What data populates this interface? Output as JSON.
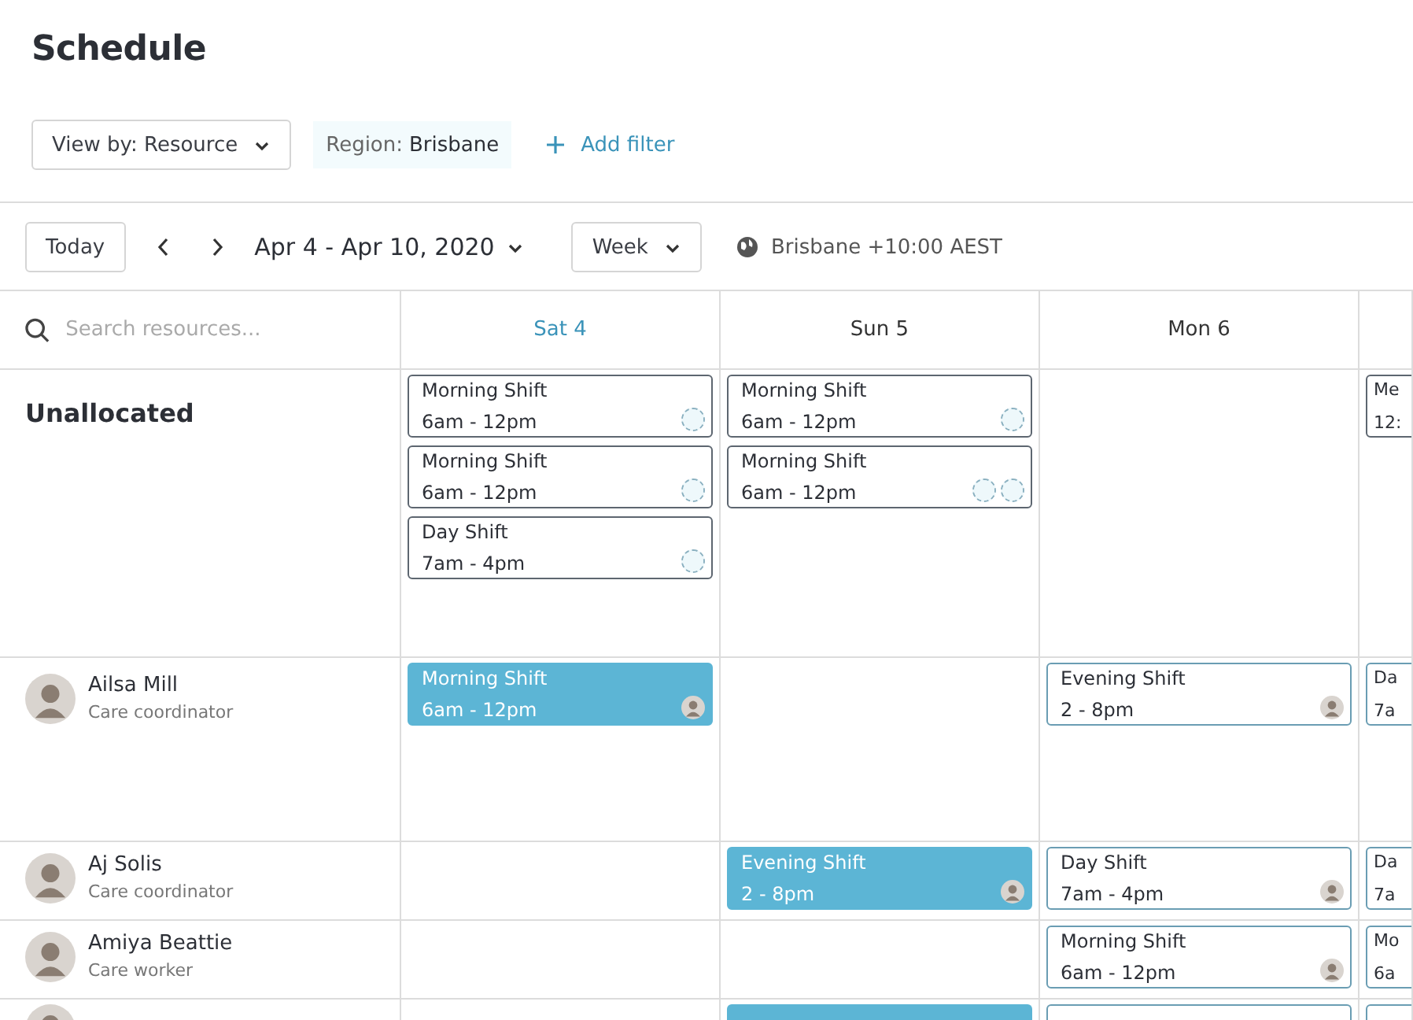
{
  "page": {
    "title": "Schedule"
  },
  "filters": {
    "view_by": "View by: Resource",
    "region_label": "Region:",
    "region_value": "Brisbane",
    "add_filter": "Add filter"
  },
  "toolbar": {
    "today": "Today",
    "date_range": "Apr 4 - Apr 10, 2020",
    "period": "Week",
    "timezone": "Brisbane +10:00 AEST"
  },
  "search": {
    "placeholder": "Search resources..."
  },
  "days": [
    {
      "label": "Sat 4",
      "selected": true
    },
    {
      "label": "Sun 5",
      "selected": false
    },
    {
      "label": "Mon 6",
      "selected": false
    }
  ],
  "rows": [
    {
      "kind": "unallocated",
      "name": "Unallocated",
      "cells": [
        [
          {
            "title": "Morning Shift",
            "time": "6am - 12pm",
            "highlighted": false,
            "slots": [
              {
                "assigned": false
              }
            ]
          },
          {
            "title": "Morning Shift",
            "time": "6am - 12pm",
            "highlighted": false,
            "slots": [
              {
                "assigned": false
              }
            ]
          },
          {
            "title": "Day Shift",
            "time": "7am - 4pm",
            "highlighted": false,
            "slots": [
              {
                "assigned": false
              }
            ]
          }
        ],
        [
          {
            "title": "Morning Shift",
            "time": "6am - 12pm",
            "highlighted": false,
            "slots": [
              {
                "assigned": false
              }
            ]
          },
          {
            "title": "Morning Shift",
            "time": "6am - 12pm",
            "highlighted": false,
            "slots": [
              {
                "assigned": false
              },
              {
                "assigned": false
              }
            ]
          }
        ],
        [],
        [
          {
            "title": "Me",
            "time": "12:",
            "highlighted": false
          }
        ]
      ]
    },
    {
      "kind": "person",
      "name": "Ailsa Mill",
      "role": "Care coordinator",
      "cells": [
        [
          {
            "title": "Morning Shift",
            "time": "6am - 12pm",
            "highlighted": true,
            "slots": [
              {
                "assigned": true
              }
            ]
          }
        ],
        [],
        [
          {
            "title": "Evening Shift",
            "time": "2 - 8pm",
            "highlighted": false,
            "slots": [
              {
                "assigned": true
              }
            ]
          }
        ],
        [
          {
            "title": "Da",
            "time": "7a",
            "highlighted": false
          }
        ]
      ]
    },
    {
      "kind": "person",
      "name": "Aj Solis",
      "role": "Care coordinator",
      "cells": [
        [],
        [
          {
            "title": "Evening Shift",
            "time": "2 - 8pm",
            "highlighted": true,
            "slots": [
              {
                "assigned": true
              }
            ]
          }
        ],
        [
          {
            "title": "Day Shift",
            "time": "7am - 4pm",
            "highlighted": false,
            "slots": [
              {
                "assigned": true
              }
            ]
          }
        ],
        [
          {
            "title": "Da",
            "time": "7a",
            "highlighted": false
          }
        ]
      ]
    },
    {
      "kind": "person",
      "name": "Amiya Beattie",
      "role": "Care worker",
      "cells": [
        [],
        [],
        [
          {
            "title": "Morning Shift",
            "time": "6am - 12pm",
            "highlighted": false,
            "slots": [
              {
                "assigned": true
              }
            ]
          }
        ],
        [
          {
            "title": "Mo",
            "time": "6a",
            "highlighted": false
          }
        ]
      ]
    }
  ]
}
